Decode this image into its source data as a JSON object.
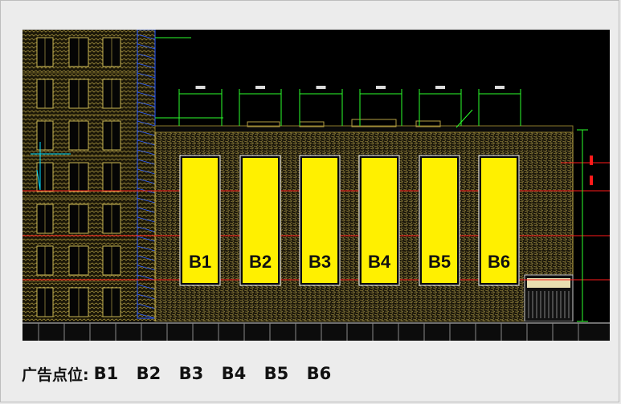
{
  "legend": {
    "title": "广告点位:",
    "items": [
      "B1",
      "B2",
      "B3",
      "B4",
      "B5",
      "B6"
    ]
  },
  "billboards": [
    {
      "label": "B1"
    },
    {
      "label": "B2"
    },
    {
      "label": "B3"
    },
    {
      "label": "B4"
    },
    {
      "label": "B5"
    },
    {
      "label": "B6"
    }
  ],
  "colors": {
    "billboard_fill": "#fff000",
    "guide_line": "#ff1a1a",
    "dimension": "#2bff2b",
    "facade": "#7a6a2a",
    "background": "#000000"
  }
}
